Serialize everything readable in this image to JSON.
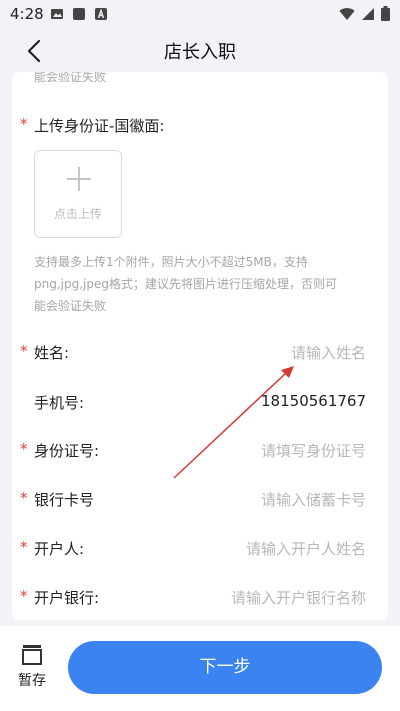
{
  "status_bar": {
    "time": "4:28"
  },
  "header": {
    "title": "店长入职"
  },
  "form": {
    "prev_hint_tail": "能会验证失败",
    "national_emblem": {
      "label": "上传身份证-国徽面:",
      "upload_text": "点击上传"
    },
    "upload_hint_line1": "支持最多上传1个附件，照片大小不超过5MB，支持",
    "upload_hint_line2": "png,jpg,jpeg格式；建议先将图片进行压缩处理，否则可",
    "upload_hint_line3": "能会验证失败",
    "name": {
      "label": "姓名:",
      "placeholder": "请输入姓名"
    },
    "phone": {
      "label": "手机号:",
      "value": "18150561767"
    },
    "id_number": {
      "label": "身份证号:",
      "placeholder": "请填写身份证号"
    },
    "bank_card": {
      "label": "银行卡号",
      "placeholder": "请输入储蓄卡号"
    },
    "account_holder": {
      "label": "开户人:",
      "placeholder": "请输入开户人姓名"
    },
    "bank_name": {
      "label": "开户银行:",
      "placeholder": "请输入开户银行名称"
    }
  },
  "bottom": {
    "draft_label": "暂存",
    "next_label": "下一步"
  },
  "colors": {
    "primary": "#3a83f1",
    "required": "#e0403a",
    "arrow": "#d23a33"
  }
}
